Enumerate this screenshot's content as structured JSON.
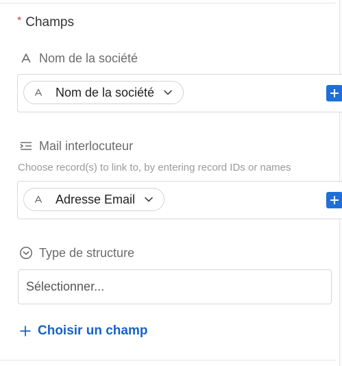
{
  "section": {
    "title": "Champs",
    "required_marker": "*"
  },
  "fields": [
    {
      "label": "Nom de la société",
      "icon": "text-a-icon",
      "chip": {
        "label": "Nom de la société",
        "icon": "text-a-icon"
      }
    },
    {
      "label": "Mail interlocuteur",
      "icon": "link-record-icon",
      "hint": "Choose record(s) to link to, by entering record IDs or names",
      "chip": {
        "label": "Adresse Email",
        "icon": "text-a-icon"
      }
    },
    {
      "label": "Type de structure",
      "icon": "select-circle-chevron-icon",
      "placeholder": "Sélectionner..."
    }
  ],
  "actions": {
    "choose_field": "Choisir un champ"
  },
  "colors": {
    "accent": "#1e6fd9",
    "link": "#1862c6",
    "required": "#d13b3b"
  }
}
